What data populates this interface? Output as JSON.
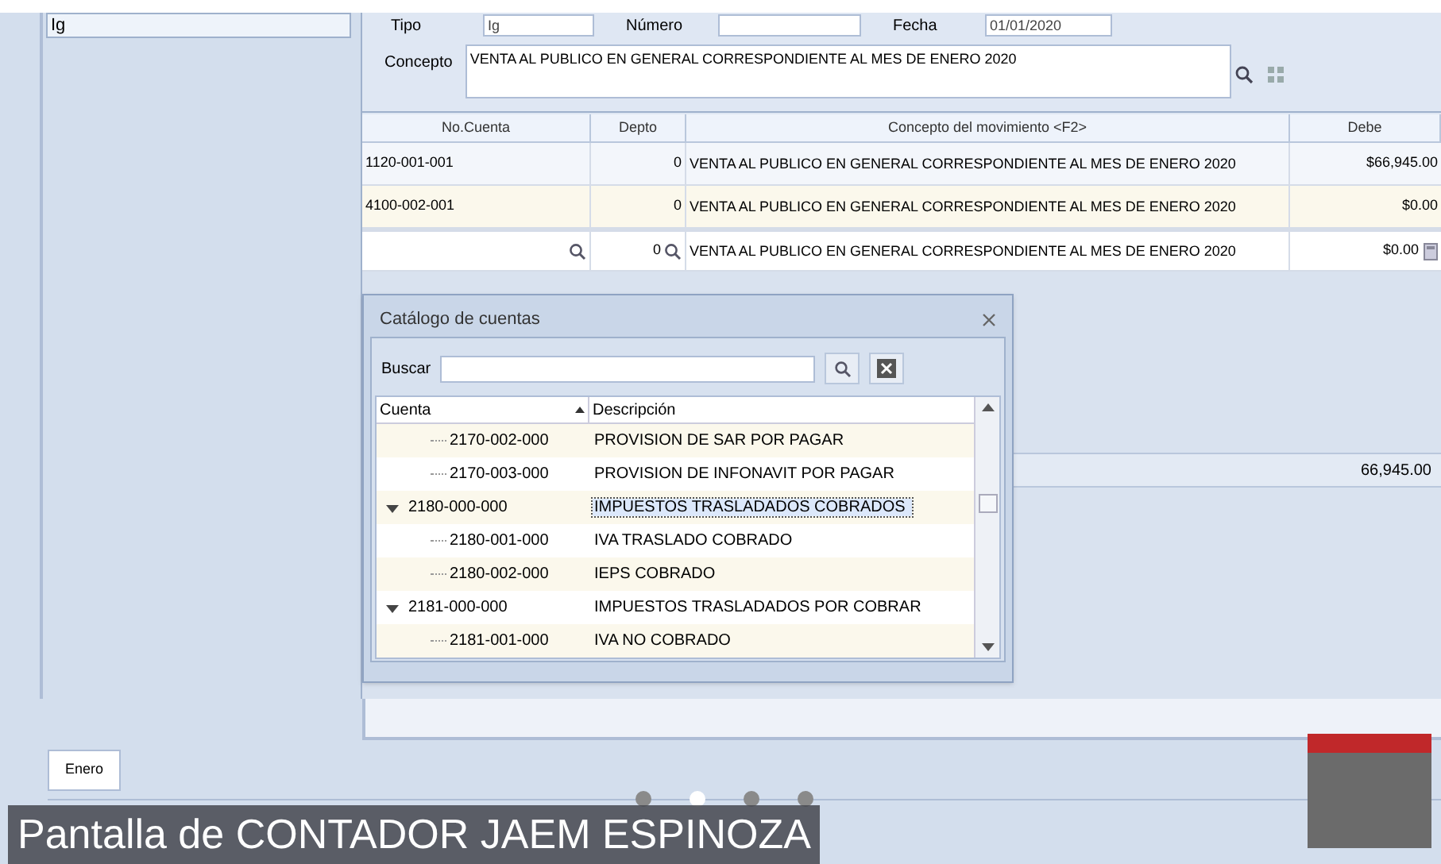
{
  "left_panel": {
    "field_value": "Ig"
  },
  "header_fields": [
    {
      "label": "Tipo",
      "value": "Ig"
    },
    {
      "label": "Número"
    },
    {
      "label": "Fecha",
      "value": "01/01/2020"
    }
  ],
  "concepto": {
    "label": "Concepto",
    "value": "VENTA AL PUBLICO EN GENERAL CORRESPONDIENTE AL MES DE ENERO 2020"
  },
  "table": {
    "columns": [
      "No.Cuenta",
      "Depto",
      "Concepto del movimiento <F2>",
      "Debe"
    ],
    "rows": [
      {
        "kind": "normal",
        "cuenta": "1120-001-001",
        "depto": "0",
        "concepto": "VENTA AL PUBLICO EN GENERAL CORRESPONDIENTE AL MES DE ENERO 2020",
        "debe": "$66,945.00"
      },
      {
        "kind": "normal",
        "cuenta": "4100-002-001",
        "depto": "0",
        "concepto": "VENTA AL PUBLICO EN GENERAL CORRESPONDIENTE AL MES DE ENERO 2020",
        "debe": "$0.00"
      },
      {
        "kind": "edit",
        "cuenta": "",
        "depto": "0",
        "concepto": "VENTA AL PUBLICO EN GENERAL CORRESPONDIENTE AL MES DE ENERO 2020",
        "debe": "$0.00"
      }
    ]
  },
  "total": "66,945.00",
  "dialog": {
    "title": "Catálogo de cuentas",
    "search_label": "Buscar",
    "columns": [
      "Cuenta",
      "Descripción"
    ],
    "tree": [
      {
        "cuenta": "2170-002-000",
        "descripcion": "PROVISION DE SAR POR PAGAR",
        "selected": false
      },
      {
        "cuenta": "2170-003-000",
        "descripcion": "PROVISION DE INFONAVIT POR PAGAR",
        "selected": false
      },
      {
        "cuenta": "2180-000-000",
        "descripcion": "IMPUESTOS TRASLADADOS COBRADOS",
        "selected": true,
        "expanded": true,
        "children": [
          {
            "cuenta": "2180-001-000",
            "descripcion": "IVA TRASLADO COBRADO",
            "selected": false
          },
          {
            "cuenta": "2180-002-000",
            "descripcion": "IEPS COBRADO",
            "selected": false
          }
        ]
      },
      {
        "cuenta": "2181-000-000",
        "descripcion": "IMPUESTOS TRASLADADOS POR COBRAR",
        "selected": false,
        "expanded": true,
        "children": [
          {
            "cuenta": "2181-001-000",
            "descripcion": "IVA NO COBRADO",
            "selected": false
          }
        ]
      }
    ]
  },
  "tabs": [
    {
      "label": "Enero",
      "selected": true
    }
  ],
  "caption": "Pantalla de CONTADOR JAEM ESPINOZA",
  "slide_dots": [
    {
      "selected": false
    },
    {
      "selected": true
    },
    {
      "selected": false
    },
    {
      "selected": false
    }
  ]
}
